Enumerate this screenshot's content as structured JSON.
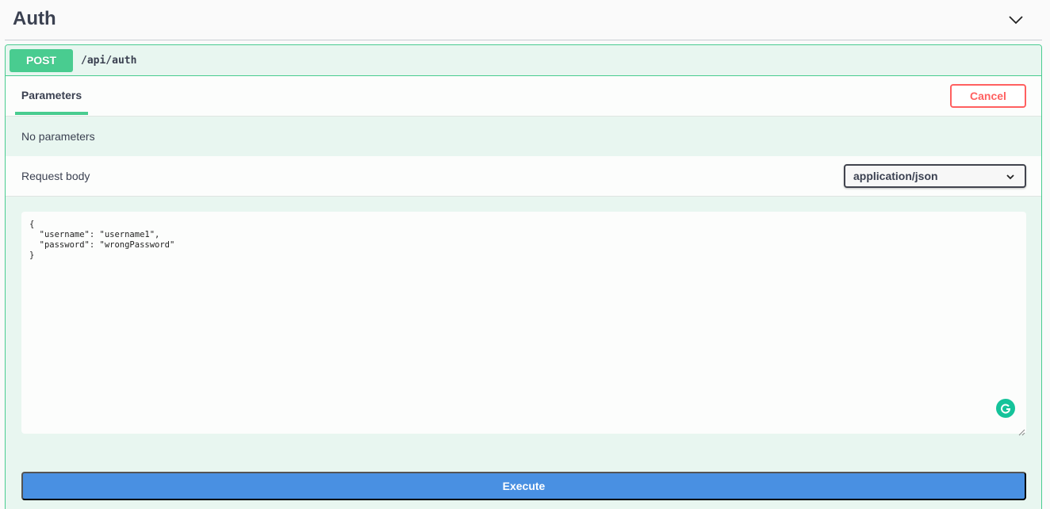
{
  "tag": {
    "title": "Auth",
    "toggle_icon": "chevron-down-icon"
  },
  "operation": {
    "method": "POST",
    "path": "/api/auth",
    "method_color": "#49cc90"
  },
  "tabs": {
    "parameters_label": "Parameters",
    "cancel_label": "Cancel"
  },
  "parameters": {
    "empty_text": "No parameters"
  },
  "request_body": {
    "label": "Request body",
    "content_type": "application/json",
    "value": "{\n  \"username\": \"username1\",\n  \"password\": \"wrongPassword\"\n}"
  },
  "actions": {
    "execute_label": "Execute",
    "execute_color": "#4990e2",
    "cancel_color": "#ff6060"
  },
  "icons": {
    "grammarly": "grammarly-icon",
    "resize": "resize-grip-icon"
  }
}
